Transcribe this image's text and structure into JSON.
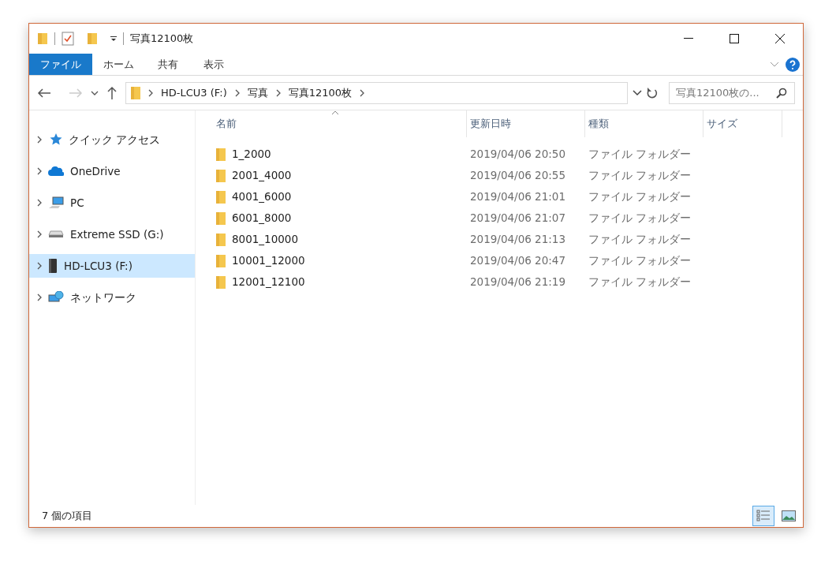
{
  "window": {
    "title": "写真12100枚"
  },
  "ribbon": {
    "tabs": [
      {
        "label": "ファイル",
        "selected": true
      },
      {
        "label": "ホーム",
        "selected": false
      },
      {
        "label": "共有",
        "selected": false
      },
      {
        "label": "表示",
        "selected": false
      }
    ]
  },
  "address": {
    "crumbs": [
      "HD-LCU3 (F:)",
      "写真",
      "写真12100枚"
    ]
  },
  "search": {
    "placeholder": "写真12100枚の..."
  },
  "nav": {
    "items": [
      {
        "label": "クイック アクセス",
        "kind": "star",
        "selected": false
      },
      {
        "label": "OneDrive",
        "kind": "cloud",
        "selected": false
      },
      {
        "label": "PC",
        "kind": "pc",
        "selected": false
      },
      {
        "label": "Extreme SSD (G:)",
        "kind": "ssd",
        "selected": false
      },
      {
        "label": "HD-LCU3 (F:)",
        "kind": "hdd",
        "selected": true
      },
      {
        "label": "ネットワーク",
        "kind": "network",
        "selected": false
      }
    ]
  },
  "table": {
    "columns": [
      "名前",
      "更新日時",
      "種類",
      "サイズ"
    ],
    "rows": [
      {
        "name": "1_2000",
        "modified": "2019/04/06 20:50",
        "type": "ファイル フォルダー"
      },
      {
        "name": "2001_4000",
        "modified": "2019/04/06 20:55",
        "type": "ファイル フォルダー"
      },
      {
        "name": "4001_6000",
        "modified": "2019/04/06 21:01",
        "type": "ファイル フォルダー"
      },
      {
        "name": "6001_8000",
        "modified": "2019/04/06 21:07",
        "type": "ファイル フォルダー"
      },
      {
        "name": "8001_10000",
        "modified": "2019/04/06 21:13",
        "type": "ファイル フォルダー"
      },
      {
        "name": "10001_12000",
        "modified": "2019/04/06 20:47",
        "type": "ファイル フォルダー"
      },
      {
        "name": "12001_12100",
        "modified": "2019/04/06 21:19",
        "type": "ファイル フォルダー"
      }
    ]
  },
  "status_bar": {
    "text": "7 個の項目",
    "views": [
      {
        "kind": "details",
        "selected": true
      },
      {
        "kind": "large",
        "selected": false
      }
    ]
  }
}
